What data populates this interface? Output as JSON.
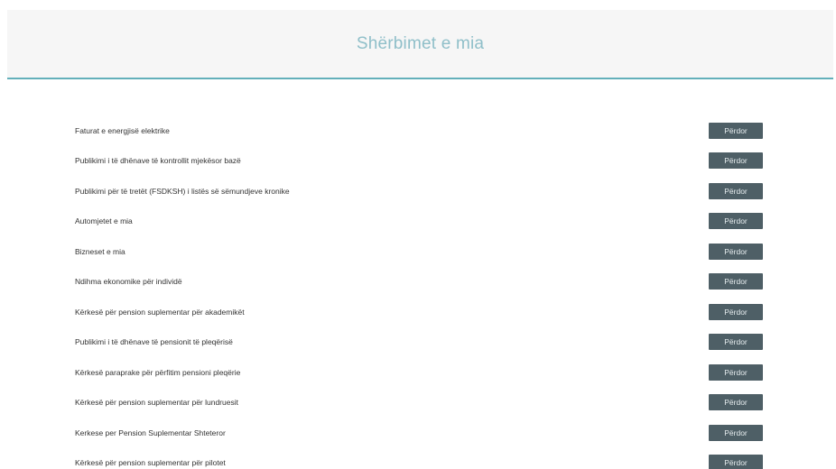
{
  "header": {
    "title": "Shërbimet e mia"
  },
  "colors": {
    "header_background": "#f6f6f6",
    "header_border": "#63b0ba",
    "title_color": "#8fbfc9",
    "button_background": "#4e5f66",
    "button_text": "#e6ecee"
  },
  "services": [
    {
      "label": "Faturat e energjisë elektrike",
      "button_label": "Përdor"
    },
    {
      "label": "Publikimi i të dhënave të kontrollit mjekësor bazë",
      "button_label": "Përdor"
    },
    {
      "label": "Publikimi për të tretët (FSDKSH) i listës së sëmundjeve kronike",
      "button_label": "Përdor"
    },
    {
      "label": "Automjetet e mia",
      "button_label": "Përdor"
    },
    {
      "label": "Bizneset e mia",
      "button_label": "Përdor"
    },
    {
      "label": "Ndihma ekonomike për individë",
      "button_label": "Përdor"
    },
    {
      "label": "Kërkesë për pension suplementar për akademikët",
      "button_label": "Përdor"
    },
    {
      "label": "Publikimi i të dhënave të pensionit të pleqërisë",
      "button_label": "Përdor"
    },
    {
      "label": "Kërkesë paraprake për përfitim pensioni pleqërie",
      "button_label": "Përdor"
    },
    {
      "label": "Kërkesë për pension suplementar për lundruesit",
      "button_label": "Përdor"
    },
    {
      "label": "Kerkese per Pension Suplementar Shteteror",
      "button_label": "Përdor"
    },
    {
      "label": "Kërkesë për pension suplementar për pilotet",
      "button_label": "Përdor"
    }
  ]
}
